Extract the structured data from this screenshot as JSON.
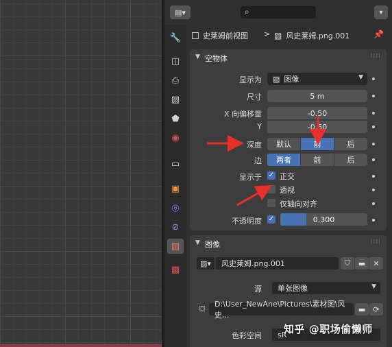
{
  "header": {
    "editor_type_icon": "properties-editor-icon",
    "search_icon": "search-icon"
  },
  "breadcrumb": {
    "object_name": "史莱姆前视图",
    "separator": ">",
    "image_name": "风史莱姆.png.001"
  },
  "empty_panel": {
    "title": "空物体",
    "display_as": {
      "label": "显示为",
      "value": "图像"
    },
    "size": {
      "label": "尺寸",
      "value": "5 m"
    },
    "x_offset": {
      "label": "X 向偏移量",
      "value": "-0.50"
    },
    "y_offset": {
      "label": "Y",
      "value": "-0.50"
    },
    "depth": {
      "label": "深度",
      "options": [
        "默认",
        "前",
        "后"
      ],
      "selected": "前"
    },
    "side": {
      "label": "边",
      "options": [
        "两者",
        "前",
        "后"
      ],
      "selected": "两者"
    },
    "show_in": {
      "label": "显示于",
      "orthographic": {
        "label": "正交",
        "checked": true
      },
      "perspective": {
        "label": "透视",
        "checked": false
      },
      "axis_aligned": {
        "label": "仅轴向对齐",
        "checked": false
      }
    },
    "opacity": {
      "label": "不透明度",
      "checked": true,
      "value": "0.300",
      "fraction": 0.3
    }
  },
  "image_panel": {
    "title": "图像",
    "image_name": "风史莱姆.png.001",
    "source": {
      "label": "源",
      "value": "单张图像"
    },
    "filepath": "D:\\User_NewAne\\Pictures\\素材图\\风史...",
    "color_space": {
      "label": "色彩空间",
      "value": "sR"
    }
  },
  "watermark": "知乎 @职场偷懒师",
  "colors": {
    "accent": "#4772b3",
    "annotation_arrow": "#e8302a"
  }
}
